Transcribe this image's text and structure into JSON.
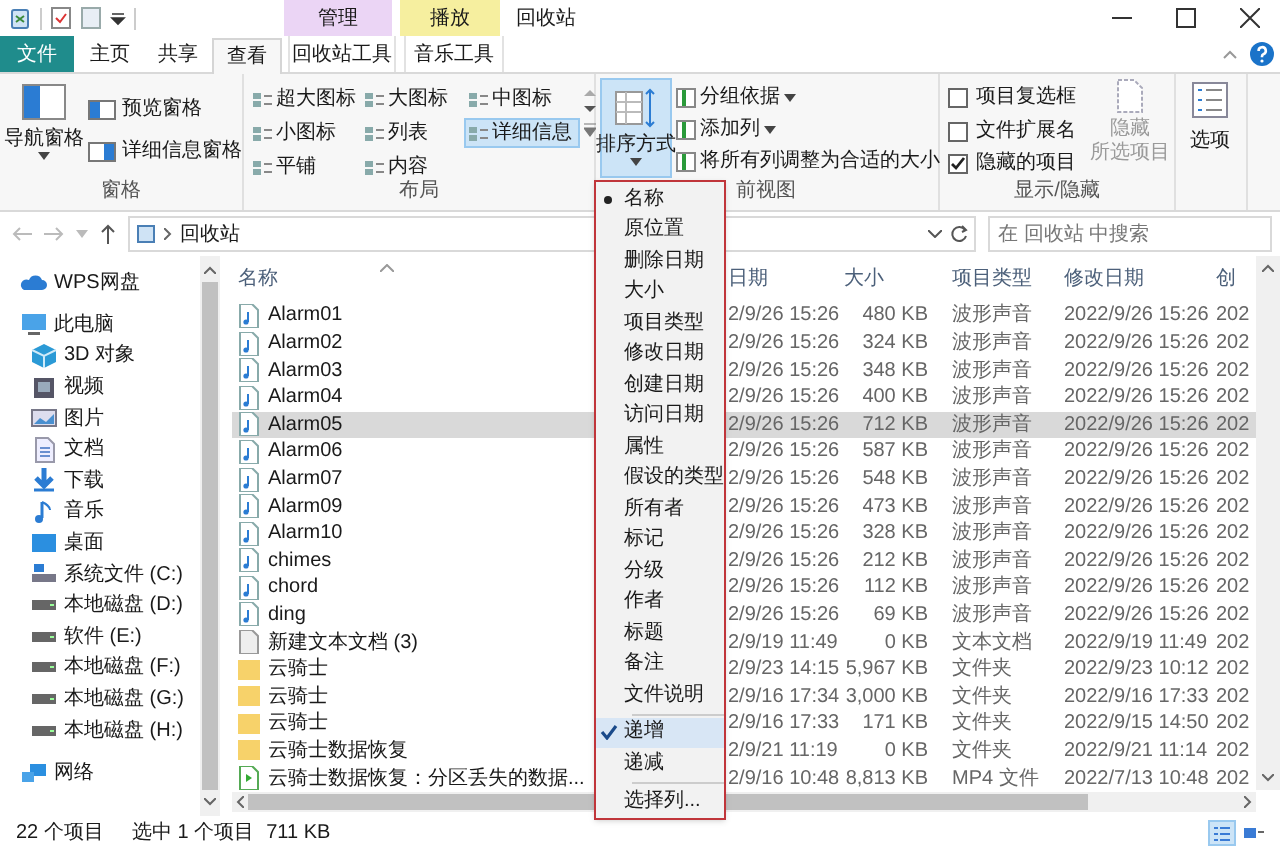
{
  "title_bar": {
    "title": "回收站",
    "context_labels": [
      {
        "label": "管理",
        "color": "#ebd5f5"
      },
      {
        "label": "播放",
        "color": "#f6ef9f"
      }
    ]
  },
  "ribbon_tabs": [
    {
      "label": "文件",
      "kind": "file",
      "selected": false
    },
    {
      "label": "主页",
      "kind": "plain",
      "selected": false
    },
    {
      "label": "共享",
      "kind": "plain",
      "selected": false
    },
    {
      "label": "查看",
      "kind": "plain",
      "selected": true
    },
    {
      "label": "回收站工具",
      "kind": "context",
      "selected": false
    },
    {
      "label": "音乐工具",
      "kind": "context",
      "selected": false
    }
  ],
  "ribbon": {
    "pane_group": {
      "label": "窗格",
      "large_button": "导航窗格",
      "items": [
        "预览窗格",
        "详细信息窗格"
      ]
    },
    "layout_group": {
      "label": "布局",
      "items": [
        {
          "label": "超大图标",
          "selected": false
        },
        {
          "label": "大图标",
          "selected": false
        },
        {
          "label": "中图标",
          "selected": false
        },
        {
          "label": "小图标",
          "selected": false
        },
        {
          "label": "列表",
          "selected": false
        },
        {
          "label": "详细信息",
          "selected": true
        },
        {
          "label": "平铺",
          "selected": false
        },
        {
          "label": "内容",
          "selected": false
        }
      ]
    },
    "view_group": {
      "label": "前视图",
      "sort_button": {
        "label": "排序方式",
        "open": true
      },
      "items": [
        {
          "label": "分组依据",
          "dropdown": true
        },
        {
          "label": "添加列",
          "dropdown": true
        },
        {
          "label": "将所有列调整为合适的大小",
          "dropdown": false
        }
      ]
    },
    "show_hide_group": {
      "label": "显示/隐藏",
      "checkboxes": [
        {
          "label": "项目复选框",
          "checked": false
        },
        {
          "label": "文件扩展名",
          "checked": false
        },
        {
          "label": "隐藏的项目",
          "checked": true
        }
      ],
      "hide_button": {
        "lines": [
          "隐藏",
          "所选项目"
        ],
        "disabled": true
      }
    },
    "options_button": "选项"
  },
  "address_bar": {
    "path": "回收站",
    "search_placeholder": "在 回收站 中搜索"
  },
  "nav": [
    {
      "label": "WPS网盘",
      "kind": "cloud"
    },
    {
      "label": "此电脑",
      "kind": "pc",
      "children": [
        {
          "label": "3D 对象",
          "kind": "cube"
        },
        {
          "label": "视频",
          "kind": "video"
        },
        {
          "label": "图片",
          "kind": "picture"
        },
        {
          "label": "文档",
          "kind": "doc"
        },
        {
          "label": "下载",
          "kind": "download"
        },
        {
          "label": "音乐",
          "kind": "music"
        },
        {
          "label": "桌面",
          "kind": "desktop"
        },
        {
          "label": "系统文件 (C:)",
          "kind": "sysdrive"
        },
        {
          "label": "本地磁盘 (D:)",
          "kind": "drive"
        },
        {
          "label": "软件 (E:)",
          "kind": "drive"
        },
        {
          "label": "本地磁盘 (F:)",
          "kind": "drive"
        },
        {
          "label": "本地磁盘 (G:)",
          "kind": "drive"
        },
        {
          "label": "本地磁盘 (H:)",
          "kind": "drive"
        }
      ]
    },
    {
      "label": "网络",
      "kind": "network"
    }
  ],
  "file_list": {
    "columns": [
      {
        "label": "名称"
      },
      {
        "label": "日期"
      },
      {
        "label": "大小"
      },
      {
        "label": "项目类型"
      },
      {
        "label": "修改日期"
      },
      {
        "label": "创"
      }
    ],
    "rows": [
      {
        "name": "Alarm01",
        "kind": "audio",
        "date": "2/9/26 15:26",
        "size": "480 KB",
        "type": "波形声音",
        "modified": "2022/9/26 15:26",
        "created": "202",
        "selected": false
      },
      {
        "name": "Alarm02",
        "kind": "audio",
        "date": "2/9/26 15:26",
        "size": "324 KB",
        "type": "波形声音",
        "modified": "2022/9/26 15:26",
        "created": "202",
        "selected": false
      },
      {
        "name": "Alarm03",
        "kind": "audio",
        "date": "2/9/26 15:26",
        "size": "348 KB",
        "type": "波形声音",
        "modified": "2022/9/26 15:26",
        "created": "202",
        "selected": false
      },
      {
        "name": "Alarm04",
        "kind": "audio",
        "date": "2/9/26 15:26",
        "size": "400 KB",
        "type": "波形声音",
        "modified": "2022/9/26 15:26",
        "created": "202",
        "selected": false
      },
      {
        "name": "Alarm05",
        "kind": "audio",
        "date": "2/9/26 15:26",
        "size": "712 KB",
        "type": "波形声音",
        "modified": "2022/9/26 15:26",
        "created": "202",
        "selected": true
      },
      {
        "name": "Alarm06",
        "kind": "audio",
        "date": "2/9/26 15:26",
        "size": "587 KB",
        "type": "波形声音",
        "modified": "2022/9/26 15:26",
        "created": "202",
        "selected": false
      },
      {
        "name": "Alarm07",
        "kind": "audio",
        "date": "2/9/26 15:26",
        "size": "548 KB",
        "type": "波形声音",
        "modified": "2022/9/26 15:26",
        "created": "202",
        "selected": false
      },
      {
        "name": "Alarm09",
        "kind": "audio",
        "date": "2/9/26 15:26",
        "size": "473 KB",
        "type": "波形声音",
        "modified": "2022/9/26 15:26",
        "created": "202",
        "selected": false
      },
      {
        "name": "Alarm10",
        "kind": "audio",
        "date": "2/9/26 15:26",
        "size": "328 KB",
        "type": "波形声音",
        "modified": "2022/9/26 15:26",
        "created": "202",
        "selected": false
      },
      {
        "name": "chimes",
        "kind": "audio",
        "date": "2/9/26 15:26",
        "size": "212 KB",
        "type": "波形声音",
        "modified": "2022/9/26 15:26",
        "created": "202",
        "selected": false
      },
      {
        "name": "chord",
        "kind": "audio",
        "date": "2/9/26 15:26",
        "size": "112 KB",
        "type": "波形声音",
        "modified": "2022/9/26 15:26",
        "created": "202",
        "selected": false
      },
      {
        "name": "ding",
        "kind": "audio",
        "date": "2/9/26 15:26",
        "size": "69 KB",
        "type": "波形声音",
        "modified": "2022/9/26 15:26",
        "created": "202",
        "selected": false
      },
      {
        "name": "新建文本文档 (3)",
        "kind": "text",
        "date": "2/9/19 11:49",
        "size": "0 KB",
        "type": "文本文档",
        "modified": "2022/9/19 11:49",
        "created": "202",
        "selected": false
      },
      {
        "name": "云骑士",
        "kind": "folder",
        "date": "2/9/23 14:15",
        "size": "5,967 KB",
        "type": "文件夹",
        "modified": "2022/9/23 10:12",
        "created": "202",
        "selected": false
      },
      {
        "name": "云骑士",
        "kind": "folder",
        "date": "2/9/16 17:34",
        "size": "3,000 KB",
        "type": "文件夹",
        "modified": "2022/9/16 17:33",
        "created": "202",
        "selected": false
      },
      {
        "name": "云骑士",
        "kind": "folder",
        "date": "2/9/16 17:33",
        "size": "171 KB",
        "type": "文件夹",
        "modified": "2022/9/15 14:50",
        "created": "202",
        "selected": false
      },
      {
        "name": "云骑士数据恢复",
        "kind": "folder",
        "date": "2/9/21 11:19",
        "size": "0 KB",
        "type": "文件夹",
        "modified": "2022/9/21 11:14",
        "created": "202",
        "selected": false
      },
      {
        "name": "云骑士数据恢复：分区丢失的数据...",
        "kind": "video",
        "date": "2/9/16 10:48",
        "size": "8,813 KB",
        "type": "MP4 文件",
        "modified": "2022/7/13 10:48",
        "created": "202",
        "selected": false
      }
    ]
  },
  "sort_menu": {
    "fields": [
      {
        "label": "名称",
        "selected": true
      },
      {
        "label": "原位置",
        "selected": false
      },
      {
        "label": "删除日期",
        "selected": false
      },
      {
        "label": "大小",
        "selected": false
      },
      {
        "label": "项目类型",
        "selected": false
      },
      {
        "label": "修改日期",
        "selected": false
      },
      {
        "label": "创建日期",
        "selected": false
      },
      {
        "label": "访问日期",
        "selected": false
      },
      {
        "label": "属性",
        "selected": false
      },
      {
        "label": "假设的类型",
        "selected": false
      },
      {
        "label": "所有者",
        "selected": false
      },
      {
        "label": "标记",
        "selected": false
      },
      {
        "label": "分级",
        "selected": false
      },
      {
        "label": "作者",
        "selected": false
      },
      {
        "label": "标题",
        "selected": false
      },
      {
        "label": "备注",
        "selected": false
      },
      {
        "label": "文件说明",
        "selected": false
      }
    ],
    "order": [
      {
        "label": "递增",
        "selected": true
      },
      {
        "label": "递减",
        "selected": false
      }
    ],
    "more": "选择列..."
  },
  "status_bar": {
    "count": "22 个项目",
    "selection": "选中 1 个项目",
    "size": "711 KB",
    "views": [
      {
        "kind": "details",
        "selected": true
      },
      {
        "kind": "large",
        "selected": false
      }
    ]
  }
}
